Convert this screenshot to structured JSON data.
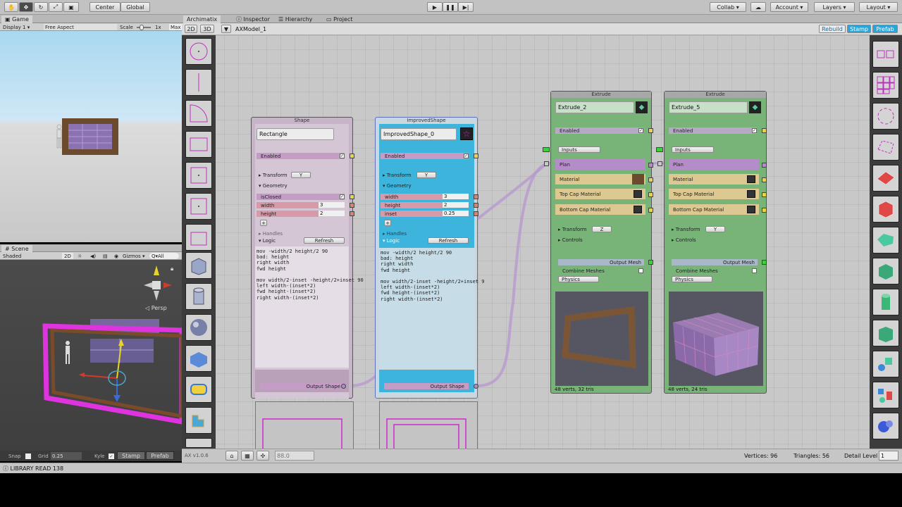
{
  "toolbar": {
    "center_label": "Center",
    "global_label": "Global",
    "collab_label": "Collab ▾",
    "account_label": "Account",
    "layers_label": "Layers",
    "layout_label": "Layout"
  },
  "game": {
    "tab": "Game",
    "display": "Display 1",
    "aspect": "Free Aspect",
    "scale_label": "Scale",
    "scale_value": "1x",
    "max_label": "Max"
  },
  "scene": {
    "tab": "Scene",
    "shading": "Shaded",
    "mode_2d": "2D",
    "gizmos": "Gizmos ▾",
    "search_placeholder": "Q▾All",
    "persp": "◁ Persp",
    "snap_label": "Snap",
    "grid_label": "Grid",
    "grid_value": "0.25",
    "kyle_label": "Kyle",
    "stamp": "Stamp",
    "prefab": "Prefab"
  },
  "ax": {
    "tabs": [
      "Archimatix",
      "Inspector",
      "Hierarchy",
      "Project"
    ],
    "mode_2d": "2D",
    "mode_3d": "3D",
    "model_name": "AXModel_1",
    "rebuild": "Rebuild",
    "stamp": "Stamp",
    "prefab": "Prefab",
    "version": "AX v1.0.6",
    "zoom": "88.0",
    "vertices": "Vertices: 96",
    "triangles": "Triangles: 56",
    "detail_label": "Detail Level",
    "detail_value": "1",
    "library_status": "LIBRARY READ 138"
  },
  "shape_node": {
    "header": "Shape",
    "name": "Rectangle",
    "enabled": "Enabled",
    "transform": "Transform",
    "transform_axis": "Y",
    "geometry": "Geometry",
    "param1": "isClosed",
    "param2": "width",
    "param2_val": "3",
    "param3": "height",
    "param3_val": "2",
    "plus": "+",
    "handles": "Handles",
    "logic": "Logic",
    "refresh": "Refresh",
    "code": "mov -width/2 height/2 90\nbad: height\nright width\nfwd height\n\nmov width/2-inset -height/2+inset 90\nleft width-(inset*2)\nfwd height-(inset*2)\nright width-(inset*2)",
    "output": "Output Shape"
  },
  "improved_node": {
    "header": "ImprovedShape",
    "name": "ImprovedShape_0",
    "enabled": "Enabled",
    "transform": "Transform",
    "transform_axis": "Y",
    "geometry": "Geometry",
    "param1": "width",
    "param1_val": "3",
    "param2": "height",
    "param2_val": "2",
    "param3": "inset",
    "param3_val": "0.25",
    "plus": "+",
    "handles": "Handles",
    "logic": "Logic",
    "refresh": "Refresh",
    "code": "mov -width/2 height/2 90\nbad: height\nright width\nfwd height\n\nmov width/2-inset -height/2+inset 9\nleft width-(inset*2)\nfwd height-(inset*2)\nright width-(inset*2)",
    "output": "Output Shape"
  },
  "extrude_nodes": [
    {
      "header": "Extrude",
      "name": "Extrude_2",
      "enabled": "Enabled",
      "inputs": "Inputs",
      "plan": "Plan",
      "material": "Material",
      "top_cap": "Top Cap Material",
      "bottom_cap": "Bottom Cap Material",
      "transform": "Transform",
      "transform_axis": "Z",
      "controls": "Controls",
      "output": "Output Mesh",
      "combine": "Combine Meshes",
      "physics": "Physics",
      "stats": "48 verts, 32 tris"
    },
    {
      "header": "Extrude",
      "name": "Extrude_5",
      "enabled": "Enabled",
      "inputs": "Inputs",
      "plan": "Plan",
      "material": "Material",
      "top_cap": "Top Cap Material",
      "bottom_cap": "Bottom Cap Material",
      "transform": "Transform",
      "transform_axis": "Y",
      "controls": "Controls",
      "output": "Output Mesh",
      "combine": "Combine Meshes",
      "physics": "Physics",
      "stats": "48 verts, 24 tris"
    }
  ],
  "colors": {
    "shape_node": "#c8b4c8",
    "improved_node": "#3cb4dc",
    "extrude_node": "#78b478",
    "plan_port": "#b48cc8",
    "material_row": "#dcc890",
    "wire": "#b89ad0"
  }
}
